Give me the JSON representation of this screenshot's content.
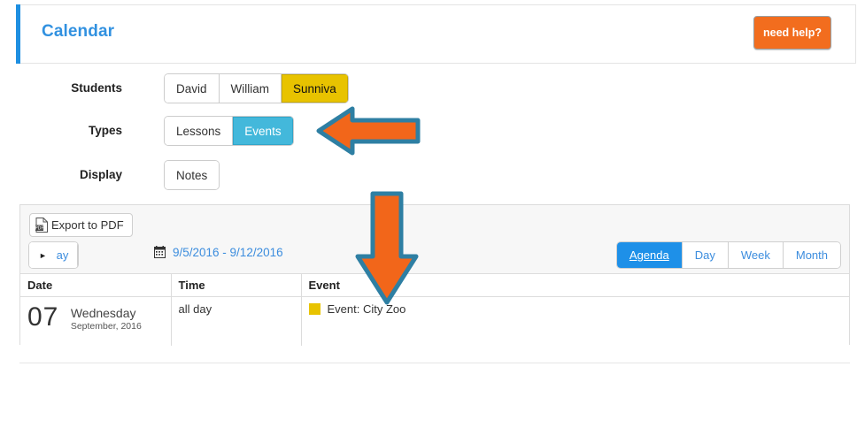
{
  "header": {
    "title": "Calendar",
    "help_button": "need help?",
    "accent_color": "#1E8FE1",
    "help_color": "#F26D1E"
  },
  "filters": [
    {
      "label": "Students",
      "name": "students",
      "options": [
        {
          "label": "David",
          "selected": false
        },
        {
          "label": "William",
          "selected": false
        },
        {
          "label": "Sunniva",
          "selected": true,
          "style": "yellow"
        }
      ]
    },
    {
      "label": "Types",
      "name": "types",
      "options": [
        {
          "label": "Lessons",
          "selected": false
        },
        {
          "label": "Events",
          "selected": true,
          "style": "cyan"
        }
      ]
    },
    {
      "label": "Display",
      "name": "display",
      "options": [
        {
          "label": "Notes",
          "selected": false
        }
      ]
    }
  ],
  "calendar": {
    "export_label": "Export to PDF",
    "today_label": "Today",
    "prev_label": "◄",
    "next_label": "►",
    "date_range": "9/5/2016 - 9/12/2016",
    "views": [
      {
        "label": "Agenda",
        "active": true
      },
      {
        "label": "Day",
        "active": false
      },
      {
        "label": "Week",
        "active": false
      },
      {
        "label": "Month",
        "active": false
      }
    ],
    "columns": [
      "Date",
      "Time",
      "Event"
    ],
    "rows": [
      {
        "day_number": "07",
        "day_name": "Wednesday",
        "day_month": "September, 2016",
        "time": "all day",
        "event": "Event: City Zoo",
        "event_color": "#E8C300"
      }
    ]
  },
  "annotations": {
    "arrow_fill": "#F2661A",
    "arrow_stroke": "#2E7FA3",
    "arrows": [
      {
        "name": "arrow-pointing-to-types-toggle",
        "direction": "left"
      },
      {
        "name": "arrow-pointing-to-event-column",
        "direction": "down"
      }
    ]
  }
}
